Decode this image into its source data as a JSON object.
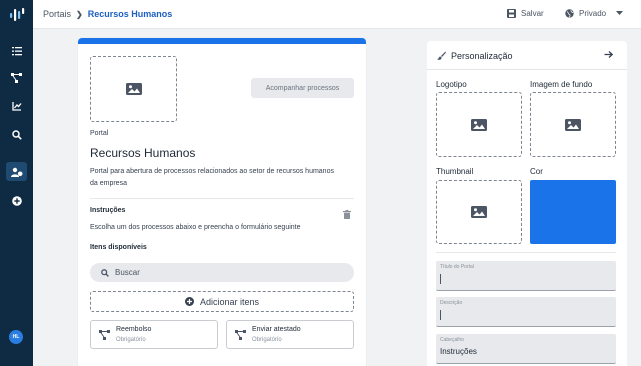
{
  "sidebar": {
    "avatar_initials": "HL",
    "items": [
      {
        "icon": "list-icon"
      },
      {
        "icon": "flow-icon"
      },
      {
        "icon": "chart-icon"
      },
      {
        "icon": "search-icon"
      },
      {
        "icon": "users-icon",
        "active": true
      },
      {
        "icon": "add-circle-icon"
      }
    ]
  },
  "header": {
    "breadcrumb_root": "Portais",
    "breadcrumb_current": "Recursos Humanos",
    "save_label": "Salvar",
    "privacy_label": "Privado"
  },
  "portal": {
    "follow_button": "Acompanhar processos",
    "type_label": "Portal",
    "title": "Recursos Humanos",
    "description": "Portal para abertura de processos relacionados ao setor de recursos humanos da empresa",
    "instructions_label": "Instruções",
    "instructions_text": "Escolha um dos processos abaixo e preencha o formulário seguinte",
    "items_label": "Itens disponíveis",
    "search_placeholder": "Buscar",
    "add_items_label": "Adicionar itens",
    "processes": [
      {
        "name": "Reembolso",
        "status": "Obrigatório"
      },
      {
        "name": "Enviar atestado",
        "status": "Obrigatório"
      }
    ]
  },
  "personalization": {
    "title": "Personalização",
    "logo_label": "Logotipo",
    "background_label": "Imagem de fundo",
    "thumbnail_label": "Thumbnail",
    "color_label": "Cor",
    "color_value": "#1a73e8",
    "fields": [
      {
        "label": "Título do Portal",
        "value": ""
      },
      {
        "label": "Descrição",
        "value": ""
      },
      {
        "label": "Cabeçalho",
        "value": "Instruções"
      }
    ]
  },
  "colors": {
    "accent": "#1a73e8",
    "sidebar": "#0f2a43",
    "link": "#1d5fc4"
  }
}
